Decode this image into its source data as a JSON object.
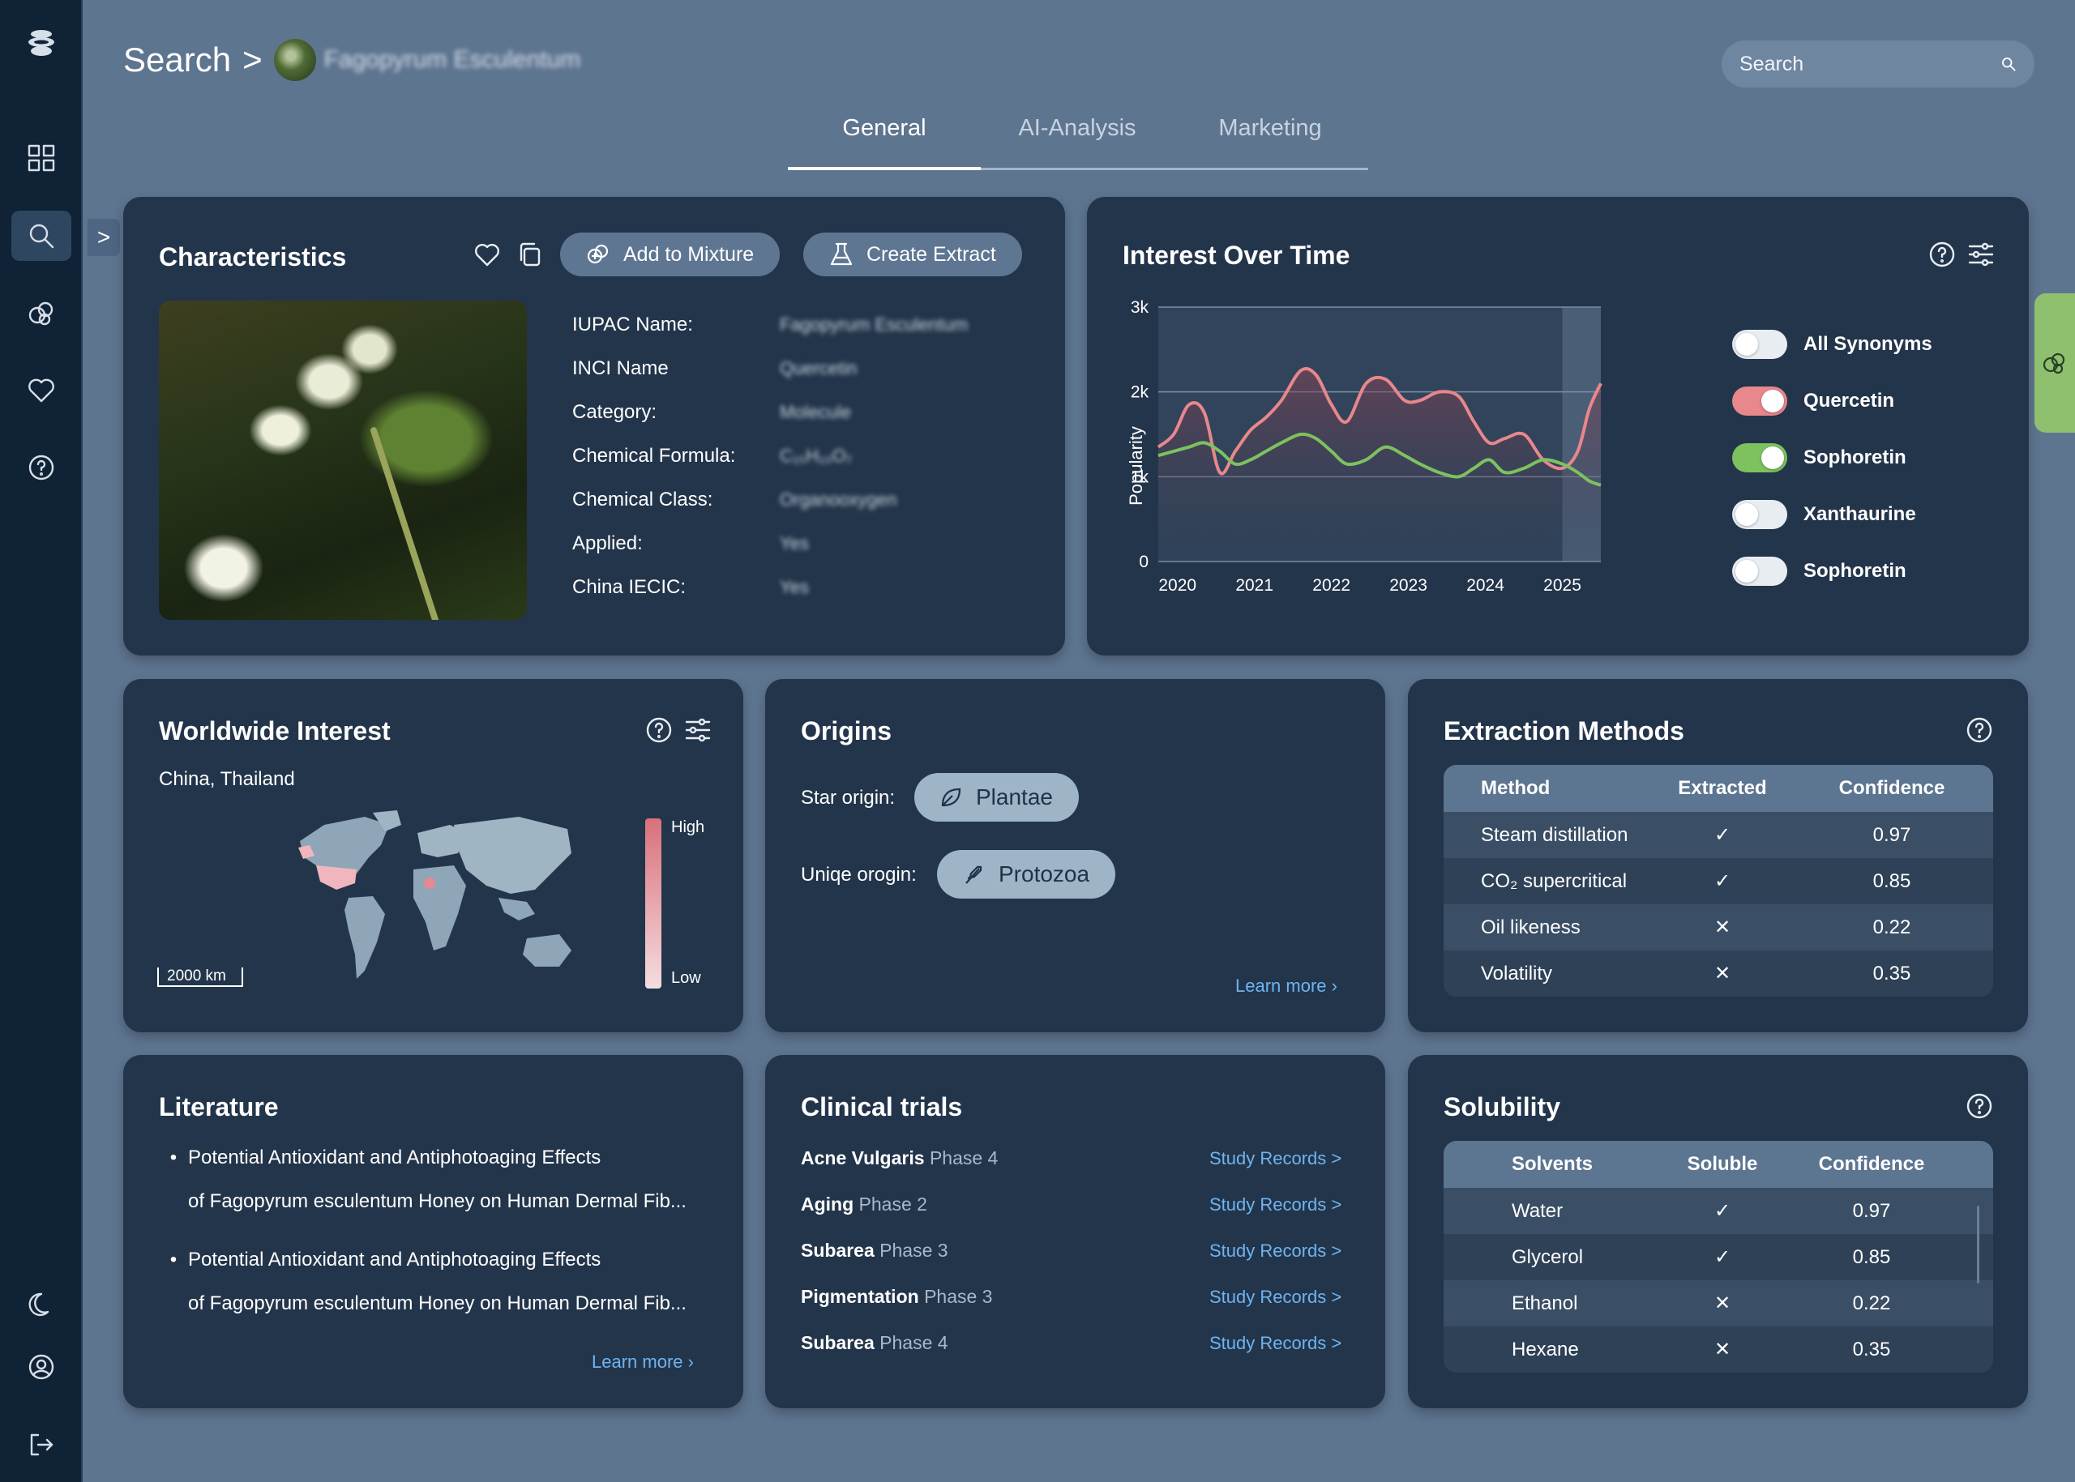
{
  "breadcrumb": {
    "root": "Search",
    "separator": ">",
    "current": "Fagopyrum Esculentum"
  },
  "search": {
    "placeholder": "Search"
  },
  "tabs": [
    "General",
    "AI-Analysis",
    "Marketing"
  ],
  "characteristics": {
    "title": "Characteristics",
    "add_to_mixture": "Add to Mixture",
    "create_extract": "Create Extract",
    "fields": [
      {
        "label": "IUPAC Name:",
        "value": "Fagopyrum Esculentum"
      },
      {
        "label": "INCI Name",
        "value": "Quercetin"
      },
      {
        "label": "Category:",
        "value": "Molecule"
      },
      {
        "label": "Chemical Formula:",
        "value": "C₁₅H₁₀O₇"
      },
      {
        "label": "Chemical Class:",
        "value": "Organooxygen"
      },
      {
        "label": "Applied:",
        "value": "Yes"
      },
      {
        "label": "China IECIC:",
        "value": "Yes"
      }
    ]
  },
  "interest_over_time": {
    "title": "Interest Over Time",
    "toggles": [
      {
        "label": "All Synonyms",
        "on": false,
        "color": "#e8edf2"
      },
      {
        "label": "Quercetin",
        "on": true,
        "color": "#e8878c"
      },
      {
        "label": "Sophoretin",
        "on": true,
        "color": "#7dc25f"
      },
      {
        "label": "Xanthaurine",
        "on": false,
        "color": "#e8edf2"
      },
      {
        "label": "Sophoretin",
        "on": false,
        "color": "#e8edf2"
      }
    ]
  },
  "chart_data": {
    "type": "line",
    "ylabel": "Popularity",
    "xlabel": "",
    "x_ticks": [
      "2020",
      "2021",
      "2022",
      "2023",
      "2024",
      "2025"
    ],
    "y_ticks": [
      "0",
      "1k",
      "2k",
      "3k"
    ],
    "ylim": [
      0,
      3000
    ],
    "xlim": [
      2019.75,
      2025.5
    ],
    "grid": true,
    "series": [
      {
        "name": "Quercetin",
        "color": "#e8878c",
        "x": [
          2019.75,
          2019.95,
          2020.15,
          2020.35,
          2020.55,
          2020.75,
          2020.95,
          2021.15,
          2021.35,
          2021.6,
          2021.8,
          2022.0,
          2022.2,
          2022.45,
          2022.7,
          2022.95,
          2023.15,
          2023.4,
          2023.65,
          2023.85,
          2024.05,
          2024.25,
          2024.5,
          2024.75,
          2025.0,
          2025.2,
          2025.35,
          2025.5
        ],
        "y": [
          1350,
          1500,
          1850,
          1750,
          1050,
          1300,
          1550,
          1700,
          1900,
          2250,
          2200,
          1850,
          1650,
          2100,
          2150,
          1900,
          1900,
          2000,
          1950,
          1650,
          1400,
          1450,
          1500,
          1200,
          1100,
          1300,
          1800,
          2100
        ]
      },
      {
        "name": "Sophoretin",
        "color": "#7dc25f",
        "x": [
          2019.75,
          2019.95,
          2020.15,
          2020.35,
          2020.55,
          2020.75,
          2020.95,
          2021.15,
          2021.35,
          2021.6,
          2021.8,
          2022.0,
          2022.2,
          2022.45,
          2022.7,
          2022.95,
          2023.15,
          2023.4,
          2023.65,
          2023.85,
          2024.05,
          2024.25,
          2024.5,
          2024.75,
          2025.0,
          2025.2,
          2025.35,
          2025.5
        ],
        "y": [
          1250,
          1300,
          1350,
          1400,
          1300,
          1150,
          1200,
          1300,
          1400,
          1500,
          1450,
          1300,
          1150,
          1200,
          1350,
          1250,
          1150,
          1050,
          1000,
          1100,
          1200,
          1050,
          1100,
          1200,
          1150,
          1050,
          950,
          900
        ]
      }
    ]
  },
  "worldwide_interest": {
    "title": "Worldwide Interest",
    "countries": "China, Thailand",
    "scale": "2000 km",
    "legend_high": "High",
    "legend_low": "Low"
  },
  "origins": {
    "title": "Origins",
    "star_label": "Star origin:",
    "star_value": "Plantae",
    "unique_label": "Uniqe orogin:",
    "unique_value": "Protozoa",
    "learn_more": "Learn more"
  },
  "extraction": {
    "title": "Extraction Methods",
    "headers": [
      "Method",
      "Extracted",
      "Confidence"
    ],
    "rows": [
      [
        "Steam distillation",
        "✓",
        "0.97"
      ],
      [
        "CO₂ supercritical",
        "✓",
        "0.85"
      ],
      [
        "Oil likeness",
        "✕",
        "0.22"
      ],
      [
        "Volatility",
        "✕",
        "0.35"
      ]
    ]
  },
  "literature": {
    "title": "Literature",
    "items": [
      {
        "line1": "Potential Antioxidant and Antiphotoaging Effects",
        "line2": "of Fagopyrum esculentum Honey on Human Dermal Fib..."
      },
      {
        "line1": "Potential Antioxidant and Antiphotoaging Effects",
        "line2": "of Fagopyrum esculentum Honey on Human Dermal Fib..."
      }
    ],
    "learn_more": "Learn more"
  },
  "clinical": {
    "title": "Clinical trials",
    "link_label": "Study Records >",
    "items": [
      {
        "name": "Acne Vulgaris",
        "phase": "Phase 4"
      },
      {
        "name": "Aging",
        "phase": "Phase 2"
      },
      {
        "name": "Subarea",
        "phase": "Phase 3"
      },
      {
        "name": "Pigmentation",
        "phase": "Phase 3"
      },
      {
        "name": "Subarea",
        "phase": "Phase 4"
      }
    ]
  },
  "solubility": {
    "title": "Solubility",
    "headers": [
      "Solvents",
      "Soluble",
      "Confidence"
    ],
    "rows": [
      [
        "Water",
        "✓",
        "0.97"
      ],
      [
        "Glycerol",
        "✓",
        "0.85"
      ],
      [
        "Ethanol",
        "✕",
        "0.22"
      ],
      [
        "Hexane",
        "✕",
        "0.35"
      ]
    ]
  }
}
